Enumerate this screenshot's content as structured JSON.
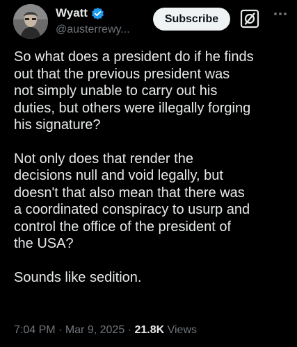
{
  "author": {
    "display_name": "Wyatt",
    "handle": "@austerrewy...",
    "verified": true,
    "verified_color": "#1d9bf0",
    "avatar_icon": "profile-photo"
  },
  "actions": {
    "subscribe_label": "Subscribe",
    "grok_icon": "grok-icon",
    "more_icon": "more-icon"
  },
  "post": {
    "paragraphs": [
      "So what does a president do if he finds\nout that the previous president was\nnot simply unable to carry out his\nduties, but others were illegally forging\nhis signature?",
      "Not only does that render the\ndecisions null and void legally, but\ndoesn't that also mean that there was\na coordinated conspiracy to usurp and\ncontrol the office of the president of\nthe USA?",
      "Sounds like sedition."
    ]
  },
  "meta": {
    "time": "7:04 PM",
    "separator": "·",
    "date": "Mar 9, 2025",
    "views_count": "21.8K",
    "views_label": "Views"
  },
  "colors": {
    "background": "#000000",
    "text": "#e7e9ea",
    "secondary_text": "#71767b",
    "button_bg": "#eff3f4"
  }
}
